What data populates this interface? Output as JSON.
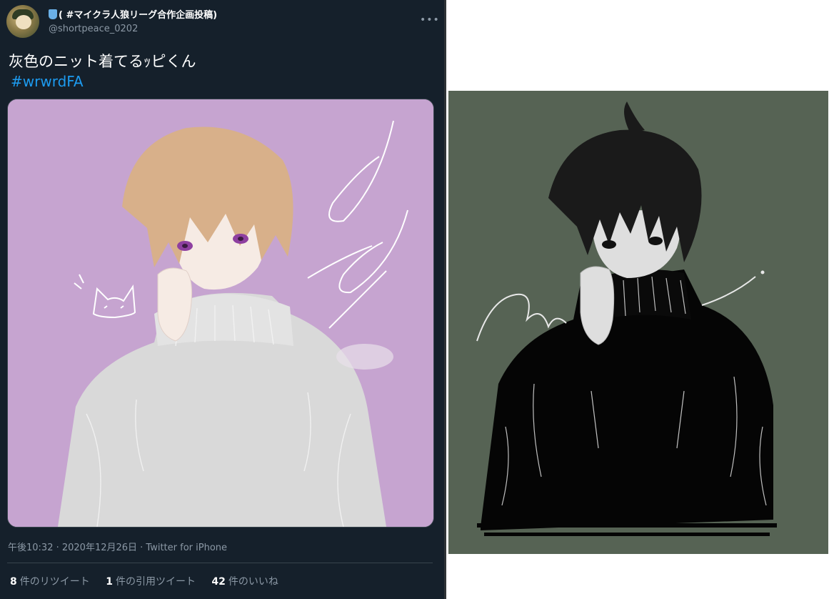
{
  "tweet": {
    "display_name": "( #マイクラ人狼リーグ合作企画投稿)",
    "handle": "@shortpeace_0202",
    "more_icon": "more-horizontal-icon",
    "text": "灰色のニット着てるｯピくん",
    "hashtag": "#wrwrdFA",
    "timestamp": "午後10:32 · 2020年12月26日 · Twitter for iPhone",
    "stats": {
      "retweets_count": "8",
      "retweets_label": "件のリツイート",
      "quotes_count": "1",
      "quotes_label": "件の引用ツイート",
      "likes_count": "42",
      "likes_label": "件のいいね"
    }
  },
  "colors": {
    "tweet_bg": "#15202b",
    "hashtag": "#1d9bf0",
    "illustration_bg_purple": "#c6a4d0",
    "illustration_bg_green": "#566354"
  }
}
